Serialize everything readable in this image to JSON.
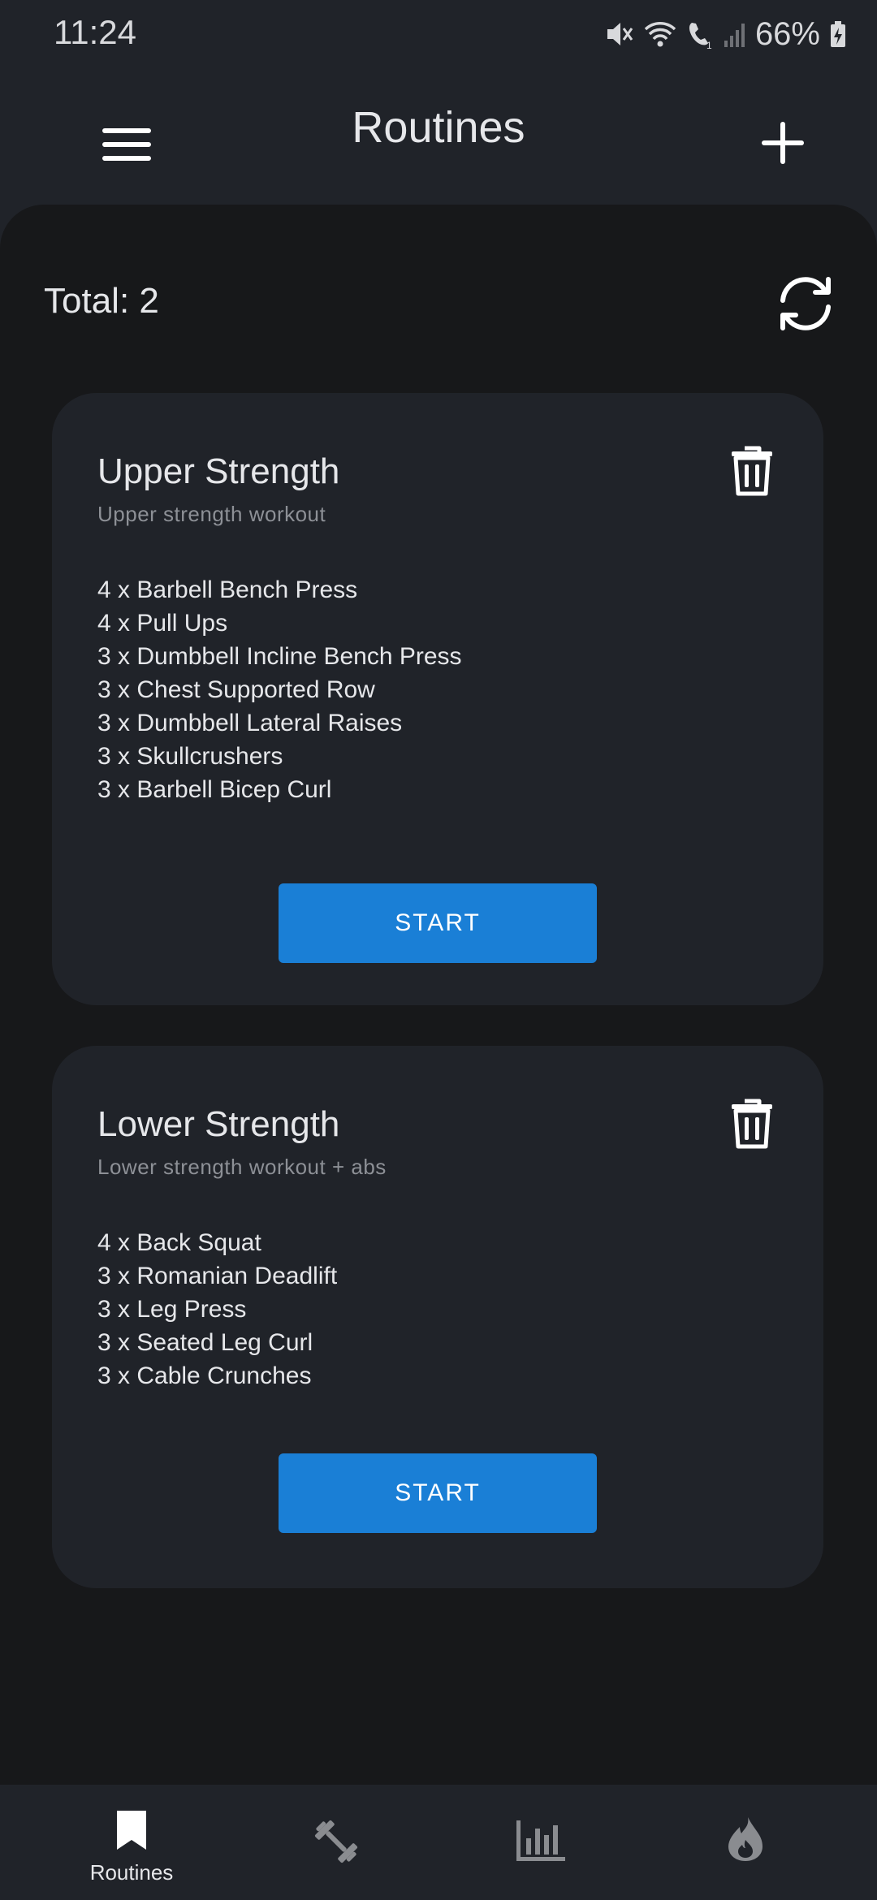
{
  "status_bar": {
    "time": "11:24",
    "battery": "66%",
    "icons": [
      "mute-icon",
      "wifi-icon",
      "wifi-calling-icon",
      "signal-icon",
      "battery-charging-icon"
    ]
  },
  "app_bar": {
    "title": "Routines",
    "menu_icon": "hamburger-menu-icon",
    "add_icon": "plus-icon"
  },
  "summary": {
    "total": "Total: 2",
    "refresh_icon": "refresh-icon"
  },
  "routines": [
    {
      "title": "Upper Strength",
      "subtitle": "Upper strength workout",
      "exercises": [
        "4 x Barbell Bench Press",
        "4 x Pull Ups",
        "3 x Dumbbell Incline Bench Press",
        "3 x Chest Supported Row",
        "3 x Dumbbell Lateral Raises",
        "3 x Skullcrushers",
        "3 x Barbell Bicep Curl"
      ],
      "start_label": "START"
    },
    {
      "title": "Lower Strength",
      "subtitle": "Lower strength workout + abs",
      "exercises": [
        "4 x Back Squat",
        "3 x Romanian Deadlift",
        "3 x Leg Press",
        "3 x Seated Leg Curl",
        "3 x Cable Crunches"
      ],
      "start_label": "START"
    }
  ],
  "bottom_nav": {
    "items": [
      {
        "label": "Routines",
        "icon": "bookmark-icon",
        "active": true
      },
      {
        "label": "",
        "icon": "dumbbell-icon",
        "active": false
      },
      {
        "label": "",
        "icon": "bar-chart-icon",
        "active": false
      },
      {
        "label": "",
        "icon": "flame-icon",
        "active": false
      }
    ]
  },
  "colors": {
    "background": "#202329",
    "content": "#17181a",
    "card": "#202329",
    "accent": "#1a7fd6",
    "muted_text": "#8d9096",
    "inactive_icon": "#8a8c90"
  }
}
